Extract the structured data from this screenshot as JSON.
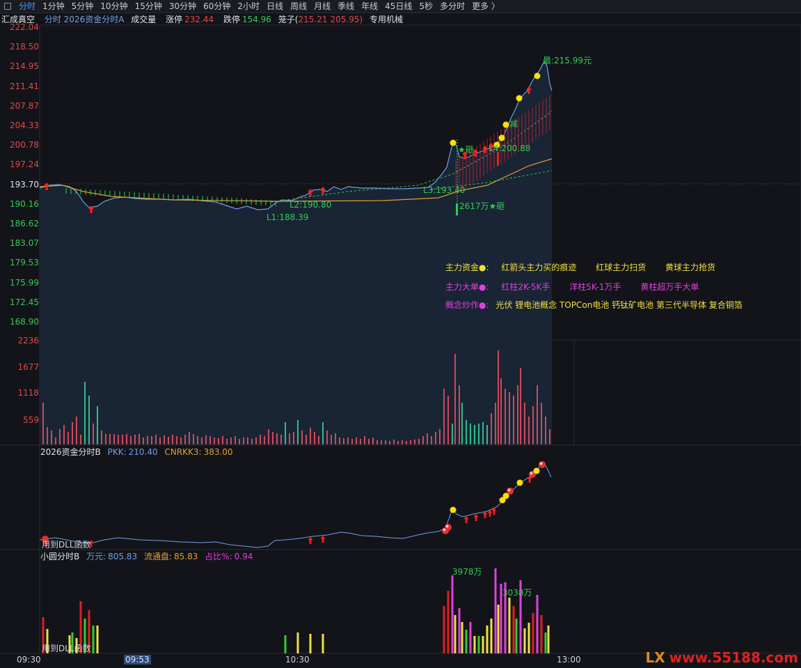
{
  "tabs": [
    "分时",
    "1分钟",
    "5分钟",
    "10分钟",
    "15分钟",
    "30分钟",
    "60分钟",
    "2小时",
    "日线",
    "周线",
    "月线",
    "季线",
    "年线",
    "45日线",
    "5秒",
    "多分时",
    "更多 〉"
  ],
  "header": {
    "stock_name": "汇成真空",
    "indicator": "分时 2026资金分时A",
    "volume_label": "成交量",
    "limit_up_label": "涨停",
    "limit_up_value": "232.44",
    "limit_down_label": "跌停",
    "limit_down_value": "154.96",
    "box_label": "笼子(",
    "box_value1": "215.21",
    "box_value2": "205.95)",
    "industry": "专用机械"
  },
  "price_axis": [
    "222.04",
    "218.50",
    "214.95",
    "211.41",
    "207.87",
    "204.33",
    "200.78",
    "197.24",
    "193.70",
    "190.16",
    "186.62",
    "183.07",
    "179.53",
    "175.99",
    "172.45",
    "168.90"
  ],
  "volume_axis": [
    "2236",
    "1677",
    "1118",
    "559"
  ],
  "annotations": {
    "high": "最:215.99元",
    "smash1": "★砸",
    "l4": "L4:200.88",
    "l3": "L3:193.40",
    "l2": "L2:190.80",
    "l1": "L1:188.39",
    "smash2": "2617万★砸",
    "reduce": "减"
  },
  "legend": {
    "row1": [
      "主力资金●:",
      "红箭头主力买的痕迹",
      "红球主力扫货",
      "黄球主力抢货"
    ],
    "row2": [
      "主力大单●:",
      "红柱2K-5K手",
      "洋柱5K-1万手",
      "黄柱超万手大单"
    ],
    "row3_label": "概念炒作●:",
    "row3_value": "光伏 锂电池概念 TOPCon电池 钙钛矿电池 第三代半导体 复合铜箔"
  },
  "panel2": {
    "title": "2026资金分时B",
    "pkk_label": "PKK:",
    "pkk_value": "210.40",
    "cnrkk_label": "CNRKK3:",
    "cnrkk_value": "383.00",
    "nodll": "用到DLL函数"
  },
  "panel3": {
    "title": "小圆分时B",
    "wan_label": "万元:",
    "wan_value": "805.83",
    "flow_label": "流通盘:",
    "flow_value": "85.83",
    "ratio_label": "占比%:",
    "ratio_value": "0.94",
    "peak1": "3978万",
    "peak2": "3038万",
    "nodll": "用到DLL函数"
  },
  "x_axis": [
    "09:30",
    "09:53",
    "10:30",
    "13:00"
  ],
  "watermark": {
    "icon": "LX",
    "text": "www.55188.com"
  },
  "colors": {
    "up": "#e04848",
    "down": "#33cc55",
    "price": "#6ea0e8",
    "avg": "#e0a030",
    "yellow": "#f0e040",
    "magenta": "#e040e0"
  }
}
